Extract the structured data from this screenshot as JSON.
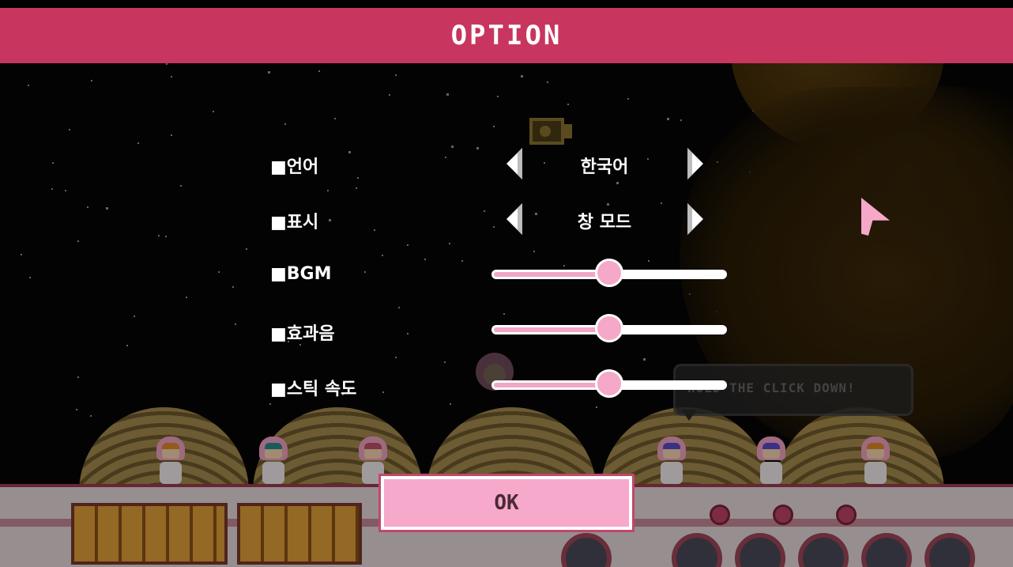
{
  "header": {
    "title": "OPTION"
  },
  "options": {
    "language": {
      "label": "■언어",
      "value": "한국어"
    },
    "display": {
      "label": "■표시",
      "value": "창 모드"
    },
    "bgm": {
      "label": "■BGM",
      "level": 0.5
    },
    "sfx": {
      "label": "■효과음",
      "level": 0.5
    },
    "stick_speed": {
      "label": "■스틱 속도",
      "level": 0.5
    }
  },
  "tooltip": {
    "text": "HOLD THE CLICK DOWN!"
  },
  "ok_button": {
    "label": "OK"
  },
  "colors": {
    "header": "#c8365f",
    "accent_pink": "#f5a8c8",
    "button_border": "#c0486a"
  },
  "icons": [
    "arrow-left-icon",
    "arrow-right-icon",
    "slider-knob",
    "pointer-cursor-icon"
  ]
}
